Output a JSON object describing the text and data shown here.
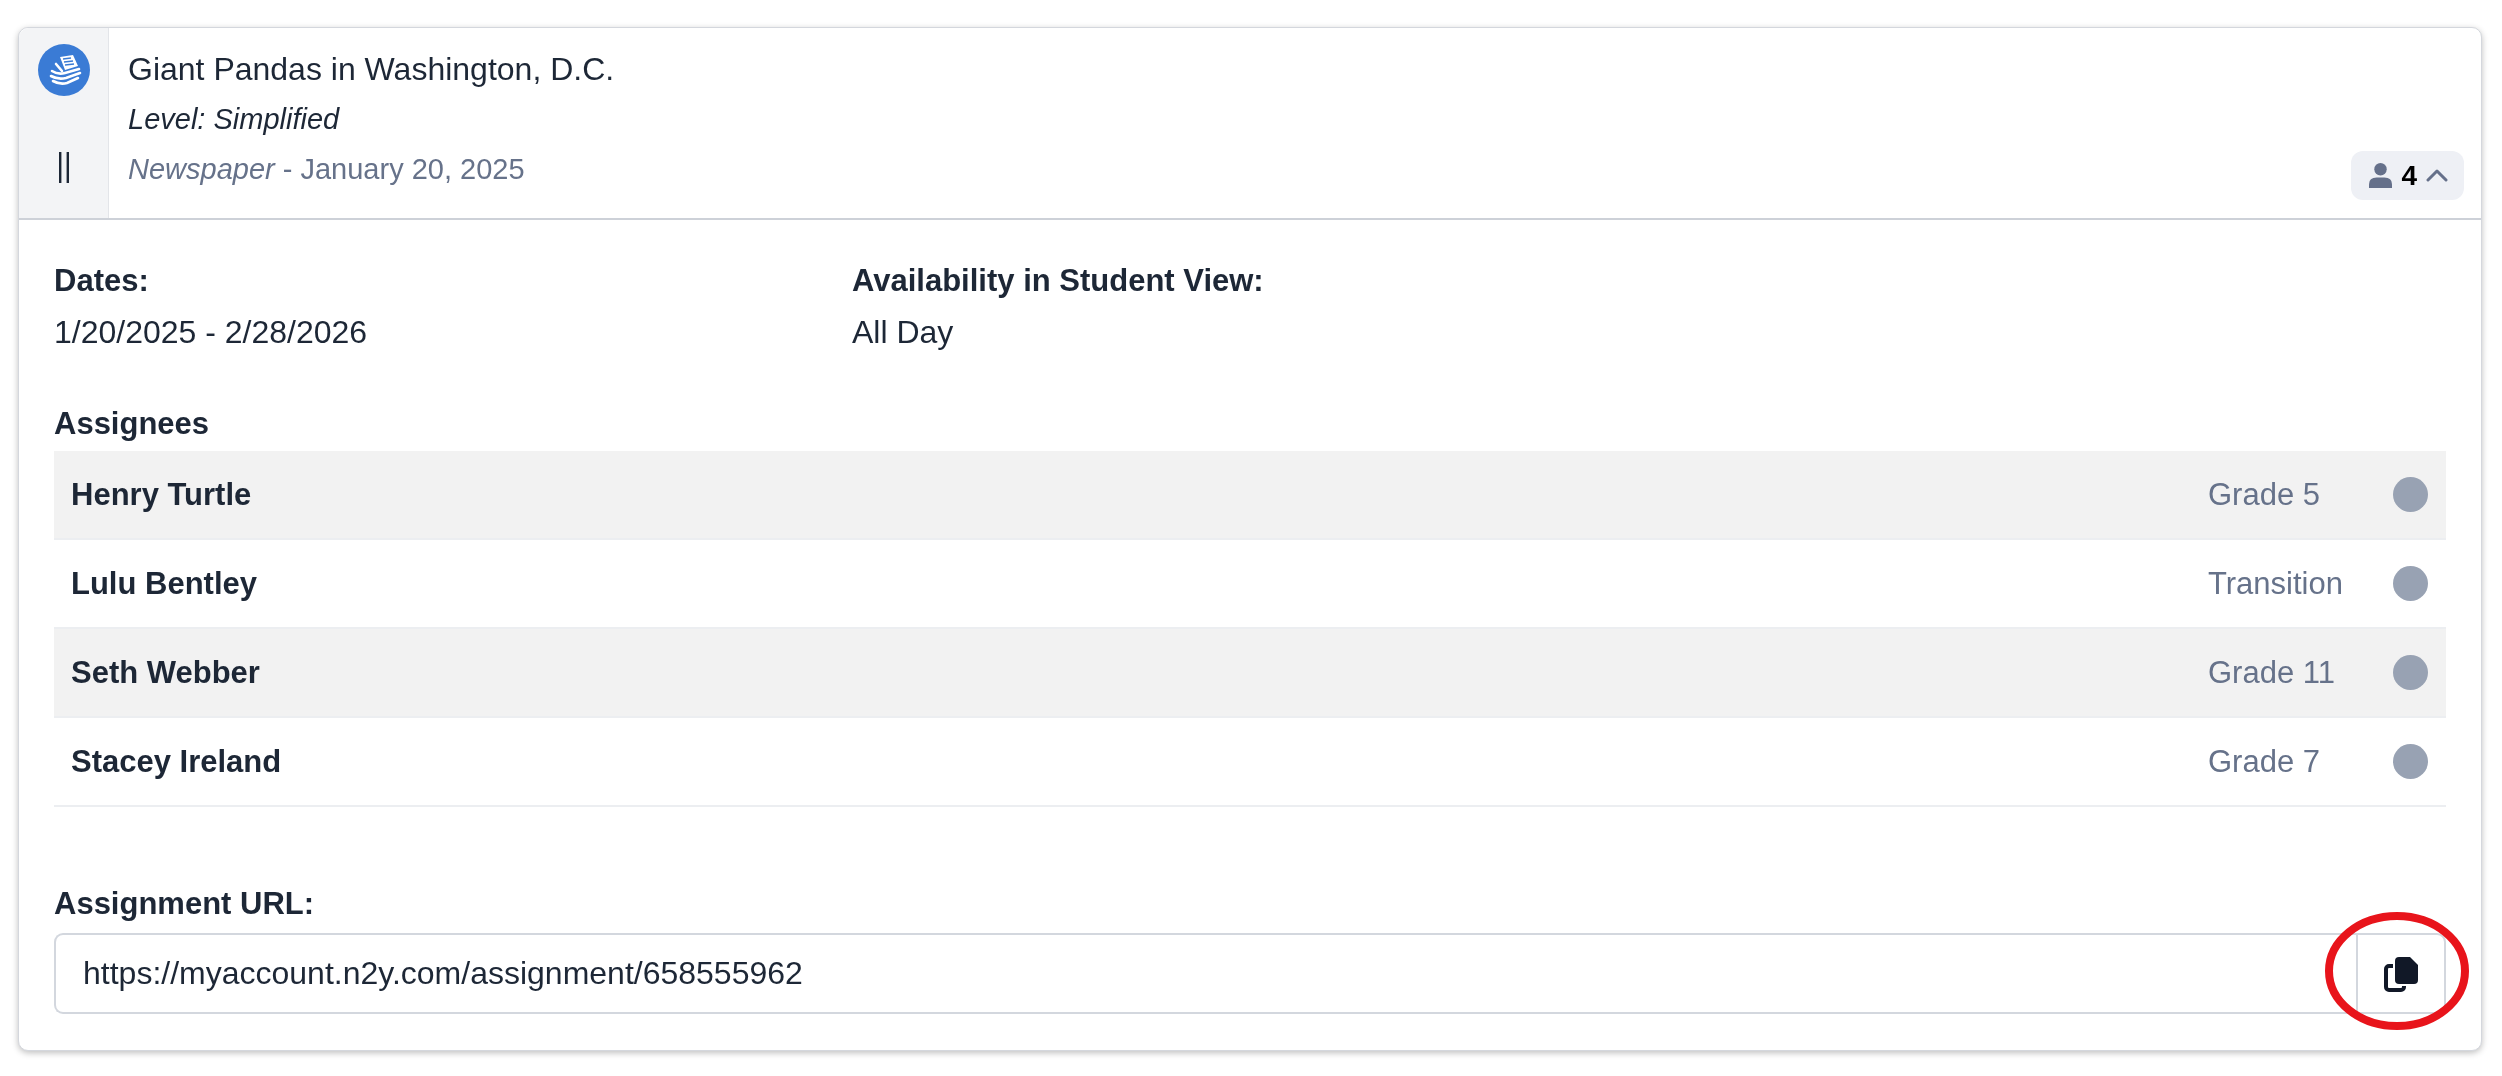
{
  "assignment": {
    "title": "Giant Pandas in Washington, D.C.",
    "level": "Level: Simplified",
    "source": "*Newspaper* - January 20, 2025",
    "assignees_toggle": {
      "count": "4",
      "expanded": true
    }
  },
  "details": [
    {
      "label": "Dates:",
      "value": "1/20/2025 - 2/28/2026"
    },
    {
      "label": "Availability in Student View:",
      "value": "All Day"
    }
  ],
  "assignees": {
    "heading": "Assignees",
    "rows": [
      {
        "name": "Henry Turtle",
        "grade": "Grade 5"
      },
      {
        "name": "Lulu Bentley",
        "grade": "Transition"
      },
      {
        "name": "Seth Webber",
        "grade": "Grade 11"
      },
      {
        "name": "Stacey Ireland",
        "grade": "Grade 7"
      }
    ]
  },
  "assignment_url": {
    "label": "Assignment URL:",
    "value": "https://myaccount.n2y.com/assignment/658555962",
    "copy_button_highlighted": true
  }
}
